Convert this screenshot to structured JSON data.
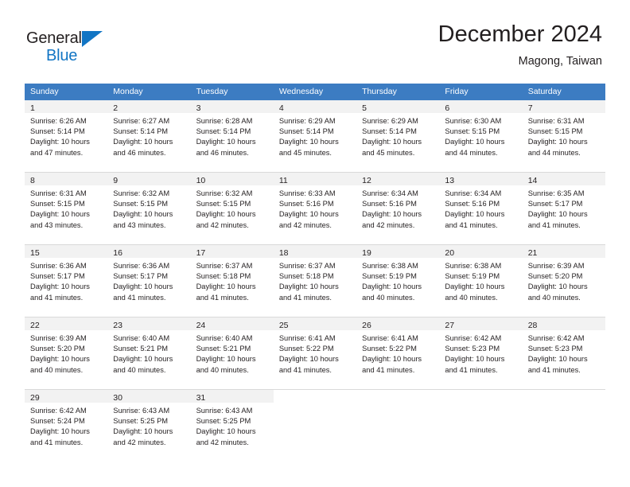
{
  "brand": {
    "name_top": "General",
    "name_bottom": "Blue",
    "triangle_color": "#1275c4",
    "text_color": "#231f20"
  },
  "header": {
    "title": "December 2024",
    "subtitle": "Magong, Taiwan"
  },
  "theme": {
    "header_band": "#3c7cc2",
    "daynum_band": "#f2f2f2",
    "row_divider": "#d9d9d9",
    "text": "#231f20",
    "header_text": "#ffffff"
  },
  "weekdays": [
    "Sunday",
    "Monday",
    "Tuesday",
    "Wednesday",
    "Thursday",
    "Friday",
    "Saturday"
  ],
  "weeks": [
    [
      {
        "day": "1",
        "sunrise": "Sunrise: 6:26 AM",
        "sunset": "Sunset: 5:14 PM",
        "daylight1": "Daylight: 10 hours",
        "daylight2": "and 47 minutes."
      },
      {
        "day": "2",
        "sunrise": "Sunrise: 6:27 AM",
        "sunset": "Sunset: 5:14 PM",
        "daylight1": "Daylight: 10 hours",
        "daylight2": "and 46 minutes."
      },
      {
        "day": "3",
        "sunrise": "Sunrise: 6:28 AM",
        "sunset": "Sunset: 5:14 PM",
        "daylight1": "Daylight: 10 hours",
        "daylight2": "and 46 minutes."
      },
      {
        "day": "4",
        "sunrise": "Sunrise: 6:29 AM",
        "sunset": "Sunset: 5:14 PM",
        "daylight1": "Daylight: 10 hours",
        "daylight2": "and 45 minutes."
      },
      {
        "day": "5",
        "sunrise": "Sunrise: 6:29 AM",
        "sunset": "Sunset: 5:14 PM",
        "daylight1": "Daylight: 10 hours",
        "daylight2": "and 45 minutes."
      },
      {
        "day": "6",
        "sunrise": "Sunrise: 6:30 AM",
        "sunset": "Sunset: 5:15 PM",
        "daylight1": "Daylight: 10 hours",
        "daylight2": "and 44 minutes."
      },
      {
        "day": "7",
        "sunrise": "Sunrise: 6:31 AM",
        "sunset": "Sunset: 5:15 PM",
        "daylight1": "Daylight: 10 hours",
        "daylight2": "and 44 minutes."
      }
    ],
    [
      {
        "day": "8",
        "sunrise": "Sunrise: 6:31 AM",
        "sunset": "Sunset: 5:15 PM",
        "daylight1": "Daylight: 10 hours",
        "daylight2": "and 43 minutes."
      },
      {
        "day": "9",
        "sunrise": "Sunrise: 6:32 AM",
        "sunset": "Sunset: 5:15 PM",
        "daylight1": "Daylight: 10 hours",
        "daylight2": "and 43 minutes."
      },
      {
        "day": "10",
        "sunrise": "Sunrise: 6:32 AM",
        "sunset": "Sunset: 5:15 PM",
        "daylight1": "Daylight: 10 hours",
        "daylight2": "and 42 minutes."
      },
      {
        "day": "11",
        "sunrise": "Sunrise: 6:33 AM",
        "sunset": "Sunset: 5:16 PM",
        "daylight1": "Daylight: 10 hours",
        "daylight2": "and 42 minutes."
      },
      {
        "day": "12",
        "sunrise": "Sunrise: 6:34 AM",
        "sunset": "Sunset: 5:16 PM",
        "daylight1": "Daylight: 10 hours",
        "daylight2": "and 42 minutes."
      },
      {
        "day": "13",
        "sunrise": "Sunrise: 6:34 AM",
        "sunset": "Sunset: 5:16 PM",
        "daylight1": "Daylight: 10 hours",
        "daylight2": "and 41 minutes."
      },
      {
        "day": "14",
        "sunrise": "Sunrise: 6:35 AM",
        "sunset": "Sunset: 5:17 PM",
        "daylight1": "Daylight: 10 hours",
        "daylight2": "and 41 minutes."
      }
    ],
    [
      {
        "day": "15",
        "sunrise": "Sunrise: 6:36 AM",
        "sunset": "Sunset: 5:17 PM",
        "daylight1": "Daylight: 10 hours",
        "daylight2": "and 41 minutes."
      },
      {
        "day": "16",
        "sunrise": "Sunrise: 6:36 AM",
        "sunset": "Sunset: 5:17 PM",
        "daylight1": "Daylight: 10 hours",
        "daylight2": "and 41 minutes."
      },
      {
        "day": "17",
        "sunrise": "Sunrise: 6:37 AM",
        "sunset": "Sunset: 5:18 PM",
        "daylight1": "Daylight: 10 hours",
        "daylight2": "and 41 minutes."
      },
      {
        "day": "18",
        "sunrise": "Sunrise: 6:37 AM",
        "sunset": "Sunset: 5:18 PM",
        "daylight1": "Daylight: 10 hours",
        "daylight2": "and 41 minutes."
      },
      {
        "day": "19",
        "sunrise": "Sunrise: 6:38 AM",
        "sunset": "Sunset: 5:19 PM",
        "daylight1": "Daylight: 10 hours",
        "daylight2": "and 40 minutes."
      },
      {
        "day": "20",
        "sunrise": "Sunrise: 6:38 AM",
        "sunset": "Sunset: 5:19 PM",
        "daylight1": "Daylight: 10 hours",
        "daylight2": "and 40 minutes."
      },
      {
        "day": "21",
        "sunrise": "Sunrise: 6:39 AM",
        "sunset": "Sunset: 5:20 PM",
        "daylight1": "Daylight: 10 hours",
        "daylight2": "and 40 minutes."
      }
    ],
    [
      {
        "day": "22",
        "sunrise": "Sunrise: 6:39 AM",
        "sunset": "Sunset: 5:20 PM",
        "daylight1": "Daylight: 10 hours",
        "daylight2": "and 40 minutes."
      },
      {
        "day": "23",
        "sunrise": "Sunrise: 6:40 AM",
        "sunset": "Sunset: 5:21 PM",
        "daylight1": "Daylight: 10 hours",
        "daylight2": "and 40 minutes."
      },
      {
        "day": "24",
        "sunrise": "Sunrise: 6:40 AM",
        "sunset": "Sunset: 5:21 PM",
        "daylight1": "Daylight: 10 hours",
        "daylight2": "and 40 minutes."
      },
      {
        "day": "25",
        "sunrise": "Sunrise: 6:41 AM",
        "sunset": "Sunset: 5:22 PM",
        "daylight1": "Daylight: 10 hours",
        "daylight2": "and 41 minutes."
      },
      {
        "day": "26",
        "sunrise": "Sunrise: 6:41 AM",
        "sunset": "Sunset: 5:22 PM",
        "daylight1": "Daylight: 10 hours",
        "daylight2": "and 41 minutes."
      },
      {
        "day": "27",
        "sunrise": "Sunrise: 6:42 AM",
        "sunset": "Sunset: 5:23 PM",
        "daylight1": "Daylight: 10 hours",
        "daylight2": "and 41 minutes."
      },
      {
        "day": "28",
        "sunrise": "Sunrise: 6:42 AM",
        "sunset": "Sunset: 5:23 PM",
        "daylight1": "Daylight: 10 hours",
        "daylight2": "and 41 minutes."
      }
    ],
    [
      {
        "day": "29",
        "sunrise": "Sunrise: 6:42 AM",
        "sunset": "Sunset: 5:24 PM",
        "daylight1": "Daylight: 10 hours",
        "daylight2": "and 41 minutes."
      },
      {
        "day": "30",
        "sunrise": "Sunrise: 6:43 AM",
        "sunset": "Sunset: 5:25 PM",
        "daylight1": "Daylight: 10 hours",
        "daylight2": "and 42 minutes."
      },
      {
        "day": "31",
        "sunrise": "Sunrise: 6:43 AM",
        "sunset": "Sunset: 5:25 PM",
        "daylight1": "Daylight: 10 hours",
        "daylight2": "and 42 minutes."
      },
      {
        "day": "",
        "sunrise": "",
        "sunset": "",
        "daylight1": "",
        "daylight2": ""
      },
      {
        "day": "",
        "sunrise": "",
        "sunset": "",
        "daylight1": "",
        "daylight2": ""
      },
      {
        "day": "",
        "sunrise": "",
        "sunset": "",
        "daylight1": "",
        "daylight2": ""
      },
      {
        "day": "",
        "sunrise": "",
        "sunset": "",
        "daylight1": "",
        "daylight2": ""
      }
    ]
  ]
}
